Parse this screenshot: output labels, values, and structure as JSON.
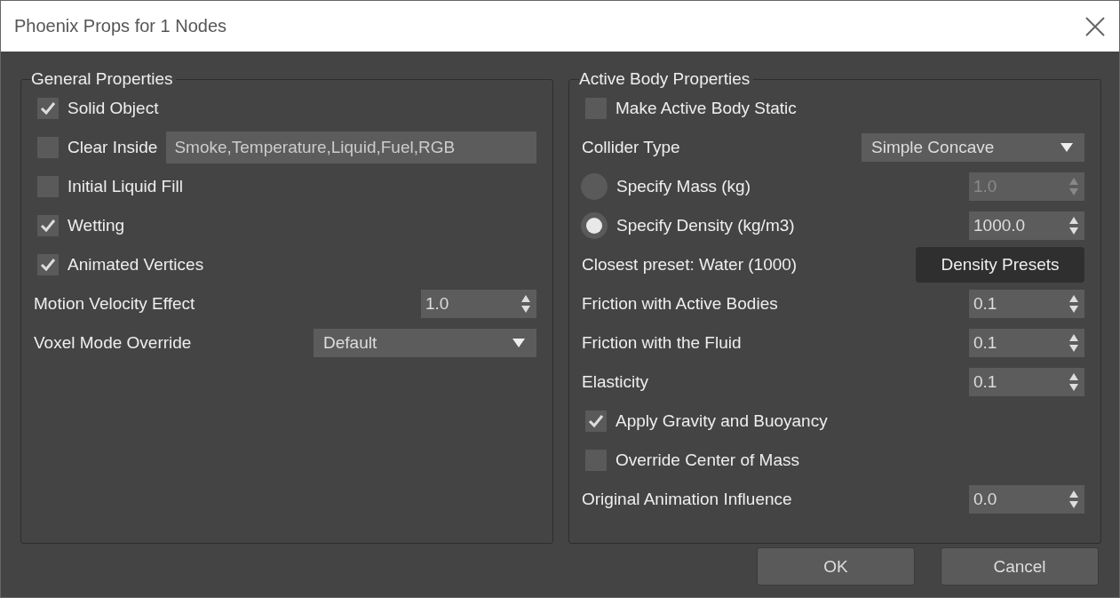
{
  "window": {
    "title": "Phoenix Props for 1 Nodes"
  },
  "panels": [
    {
      "title": "General Properties",
      "rows": [
        {
          "kind": "checkbox",
          "label": "Solid Object",
          "checked": true
        },
        {
          "kind": "checkbox_field",
          "label": "Clear Inside",
          "checked": false,
          "value": "Smoke,Temperature,Liquid,Fuel,RGB"
        },
        {
          "kind": "checkbox",
          "label": "Initial Liquid Fill",
          "checked": false
        },
        {
          "kind": "checkbox",
          "label": "Wetting",
          "checked": true
        },
        {
          "kind": "checkbox",
          "label": "Animated Vertices",
          "checked": true
        },
        {
          "kind": "spinner",
          "label": "Motion Velocity Effect",
          "value": "1.0"
        },
        {
          "kind": "dropdown",
          "label": "Voxel Mode Override",
          "value": "Default"
        }
      ]
    },
    {
      "title": "Active Body Properties",
      "rows": [
        {
          "kind": "checkbox",
          "label": "Make Active Body Static",
          "checked": false
        },
        {
          "kind": "dropdown",
          "label": "Collider Type",
          "value": "Simple Concave"
        },
        {
          "kind": "radio",
          "label": "Specify Mass (kg)",
          "selected": false,
          "value": "1.0",
          "disabled": true
        },
        {
          "kind": "radio",
          "label": "Specify Density (kg/m3)",
          "selected": true,
          "value": "1000.0",
          "disabled": false
        },
        {
          "kind": "button",
          "label": "Closest preset: Water (1000)",
          "button": "Density Presets"
        },
        {
          "kind": "spinner",
          "label": "Friction with Active Bodies",
          "value": "0.1"
        },
        {
          "kind": "spinner",
          "label": "Friction with the Fluid",
          "value": "0.1"
        },
        {
          "kind": "spinner",
          "label": "Elasticity",
          "value": "0.1"
        },
        {
          "kind": "checkbox",
          "label": "Apply Gravity and Buoyancy",
          "checked": true
        },
        {
          "kind": "checkbox",
          "label": "Override Center of Mass",
          "checked": false
        },
        {
          "kind": "spinner",
          "label": "Original Animation Influence",
          "value": "0.0"
        }
      ]
    }
  ],
  "buttons": [
    "OK",
    "Cancel"
  ]
}
